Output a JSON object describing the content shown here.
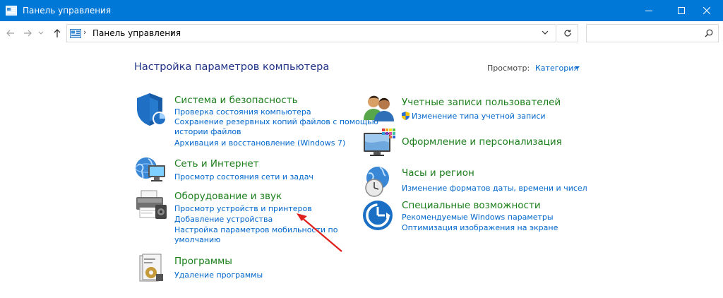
{
  "window": {
    "title": "Панель управления"
  },
  "address": {
    "crumb": "Панель управления",
    "search_placeholder": ""
  },
  "header": {
    "heading": "Настройка параметров компьютера",
    "view_label": "Просмотр:",
    "view_value": "Категория"
  },
  "categories": {
    "system": {
      "title": "Система и безопасность",
      "links": [
        "Проверка состояния компьютера",
        "Сохранение резервных копий файлов с помощью",
        "истории файлов",
        "Архивация и восстановление (Windows 7)"
      ]
    },
    "network": {
      "title": "Сеть и Интернет",
      "links": [
        "Просмотр состояния сети и задач"
      ]
    },
    "hardware": {
      "title": "Оборудование и звук",
      "links": [
        "Просмотр устройств и принтеров",
        "Добавление устройства",
        "Настройка параметров мобильности по",
        "умолчанию"
      ]
    },
    "programs": {
      "title": "Программы",
      "links": [
        "Удаление программы"
      ]
    },
    "accounts": {
      "title": "Учетные записи пользователей",
      "links": [
        "Изменение типа учетной записи"
      ]
    },
    "appearance": {
      "title": "Оформление и персонализация"
    },
    "clock": {
      "title": "Часы и регион",
      "links": [
        "Изменение форматов даты, времени и чисел"
      ]
    },
    "access": {
      "title": "Специальные возможности",
      "links": [
        "Рекомендуемые Windows параметры",
        "Оптимизация изображения на экране"
      ]
    }
  },
  "colors": {
    "titlebar": "#0078d7",
    "heading": "#1e3287",
    "category_title": "#1a7f1a",
    "link": "#0066cc",
    "annotation_arrow": "#e0201c"
  }
}
